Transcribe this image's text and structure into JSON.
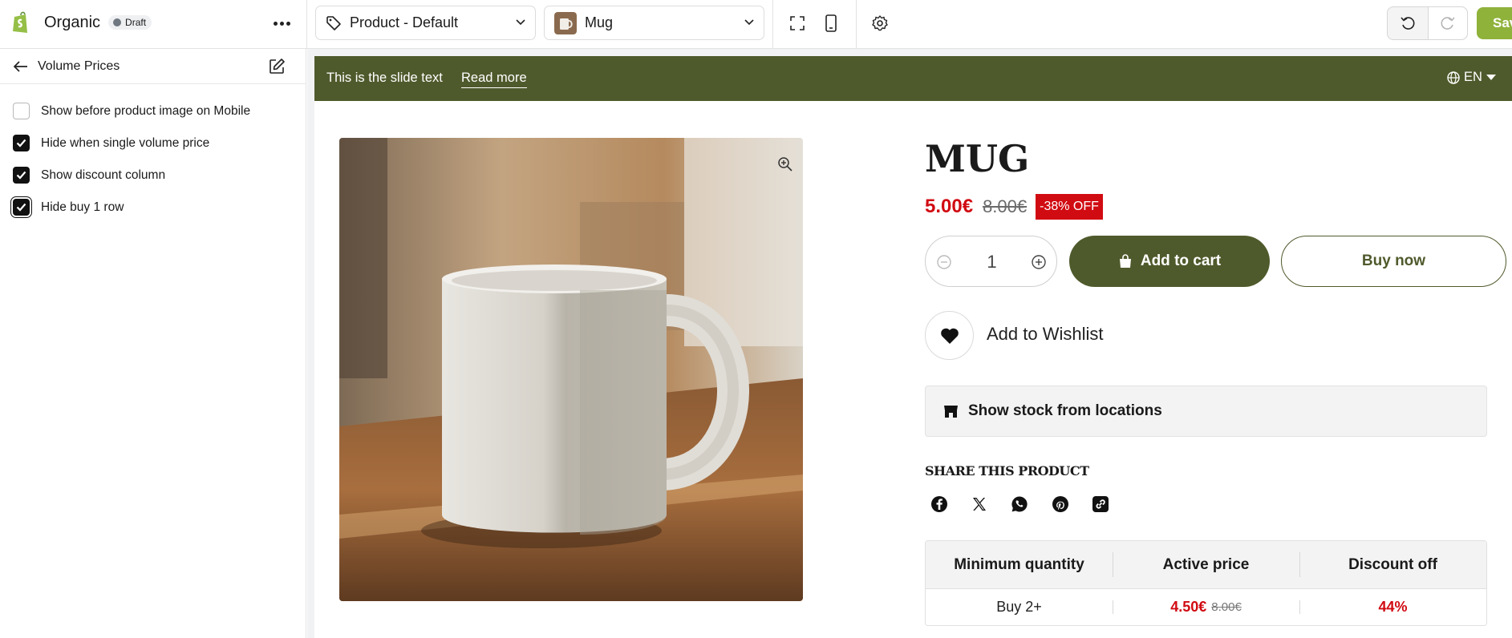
{
  "app": {
    "store_name": "Organic",
    "status_badge": "Draft",
    "template_select": "Product - Default",
    "product_select": "Mug",
    "save_label": "Save"
  },
  "sidebar": {
    "title": "Volume Prices",
    "options": [
      {
        "label": "Show before product image on Mobile",
        "checked": false
      },
      {
        "label": "Hide when single volume price",
        "checked": true
      },
      {
        "label": "Show discount column",
        "checked": true
      },
      {
        "label": "Hide buy 1 row",
        "checked": true
      }
    ]
  },
  "announcement": {
    "text": "This is the slide text",
    "link": "Read more",
    "language": "EN"
  },
  "product": {
    "title": "MUG",
    "price": "5.00€",
    "compare_price": "8.00€",
    "discount_badge": "-38% OFF",
    "quantity": "1",
    "add_to_cart": "Add to cart",
    "buy_now": "Buy now",
    "wishlist": "Add to Wishlist",
    "stock": "Show stock from locations",
    "share_title": "SHARE THIS PRODUCT",
    "share_icons": [
      "facebook-icon",
      "x-icon",
      "whatsapp-icon",
      "pinterest-icon",
      "link-icon"
    ]
  },
  "volume_table": {
    "headers": [
      "Minimum quantity",
      "Active price",
      "Discount off"
    ],
    "rows": [
      {
        "quantity": "Buy 2+",
        "price": "4.50€",
        "compare": "8.00€",
        "discount": "44%"
      }
    ]
  },
  "colors": {
    "brand_green": "#4f5a2c",
    "save_green": "#8fb23a",
    "sale_red": "#d10b12"
  }
}
